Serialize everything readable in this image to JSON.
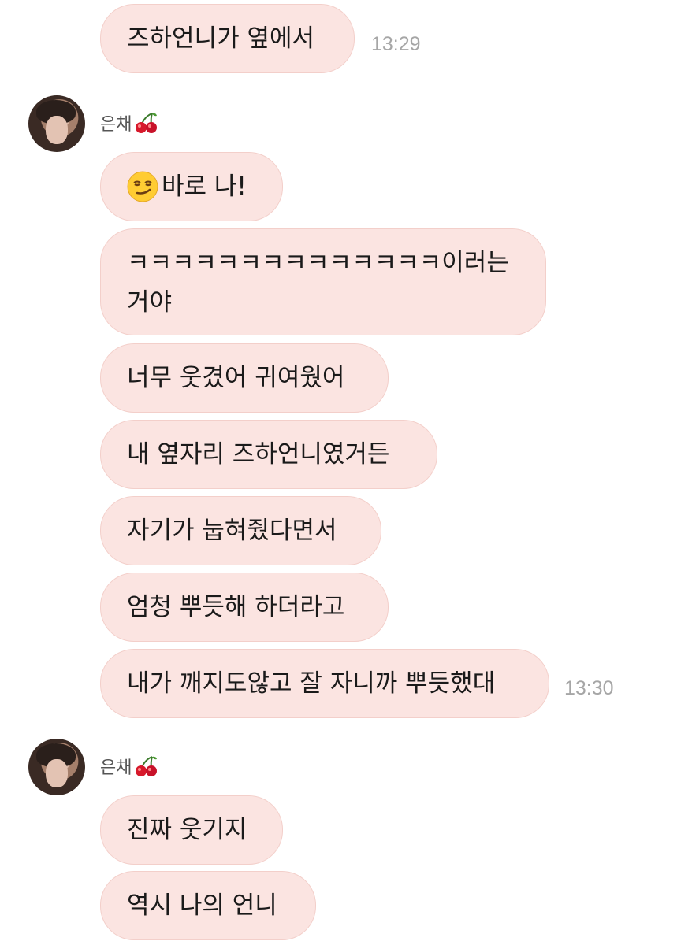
{
  "messages": [
    {
      "text": "즈하언니가 옆에서",
      "time": "13:29"
    },
    {
      "sender": "은채",
      "sender_icon": "cherry-icon",
      "avatar": "avatar"
    },
    {
      "text": "바로 나!",
      "emoji": "smirking-face-icon"
    },
    {
      "text": "ㅋㅋㅋㅋㅋㅋㅋㅋㅋㅋㅋㅋㅋㅋ이러는거야"
    },
    {
      "text": "너무 웃겼어 귀여웠어"
    },
    {
      "text": "내 옆자리 즈하언니였거든"
    },
    {
      "text": "자기가 눕혀줬다면서"
    },
    {
      "text": "엄청 뿌듯해 하더라고"
    },
    {
      "text": "내가 깨지도않고 잘 자니까 뿌듯했대",
      "time": "13:30"
    },
    {
      "sender": "은채",
      "sender_icon": "cherry-icon",
      "avatar": "avatar"
    },
    {
      "text": "진짜 웃기지"
    },
    {
      "text": "역시 나의 언니"
    }
  ],
  "colors": {
    "bubble_bg": "#fbe4e1",
    "bubble_border": "#f3cfca",
    "time": "#a6a6a6"
  }
}
